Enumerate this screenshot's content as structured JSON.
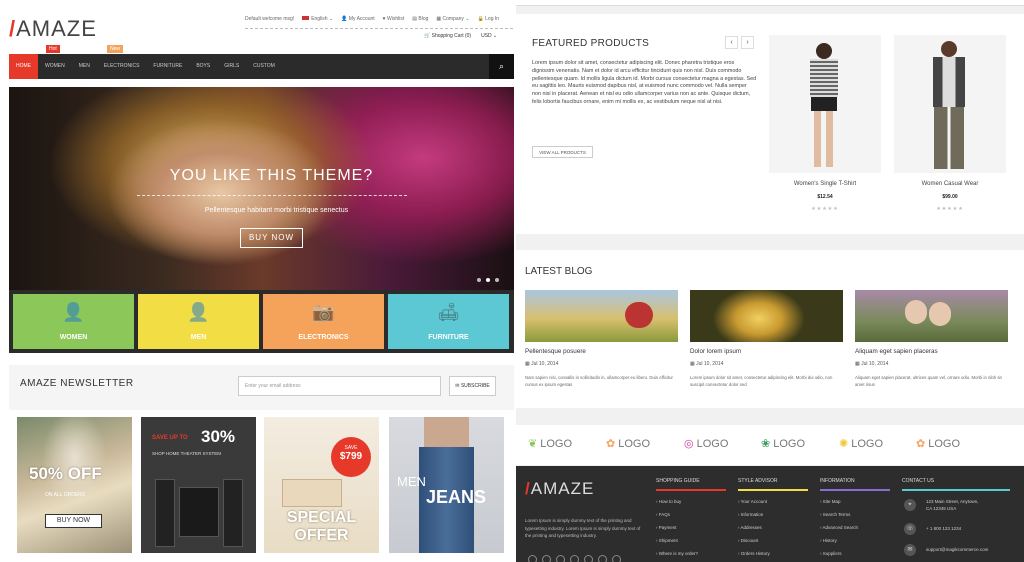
{
  "header": {
    "logo": "AMAZE",
    "welcome": "Default welcome msg!",
    "language": "English",
    "links": [
      "My Account",
      "Wishlist",
      "Blog",
      "Company"
    ],
    "login": "Log In",
    "cart": "Shopping Cart (0)",
    "currency": "USD"
  },
  "nav": {
    "items": [
      "HOME",
      "WOMEN",
      "MEN",
      "ELECTRONICS",
      "FURNITURE",
      "BOYS",
      "GIRLS",
      "CUSTOM"
    ],
    "badges": {
      "hot": "Hot",
      "new": "New"
    }
  },
  "hero": {
    "title": "YOU LIKE THIS THEME?",
    "subtitle": "Pellentesque habitant morbi tristique senectus",
    "button": "BUY NOW"
  },
  "categories": [
    {
      "label": "WOMEN",
      "color": "#8cc759"
    },
    {
      "label": "MEN",
      "color": "#f2dd44"
    },
    {
      "label": "ELECTRONICS",
      "color": "#f5a25b"
    },
    {
      "label": "FURNITURE",
      "color": "#5bc8d3"
    }
  ],
  "newsletter": {
    "title": "AMAZE NEWSLETTER",
    "placeholder": "Enter your email address",
    "button": "SUBSCRIBE"
  },
  "promos": {
    "p1": {
      "big": "50% OFF",
      "small": "ON ALL ORDERS",
      "button": "BUY NOW"
    },
    "p2": {
      "save": "SAVE UP TO",
      "pct": "30%",
      "text": "SHOP HOME THEATER SYSTEM"
    },
    "p3": {
      "save": "SAVE",
      "price": "$799",
      "line1": "SPECIAL",
      "line2": "OFFER"
    },
    "p4": {
      "line1": "MEN",
      "line2": "JEANS"
    }
  },
  "featured": {
    "title": "FEATURED PRODUCTS",
    "prev": "‹",
    "next": "›",
    "description": "Lorem ipsum dolor sit amet, consectetur adipiscing elit. Donec pharetra tristique eros dignissim venenatis. Nam et dolor id arcu efficitur tincidunt quis non nisl. Duis commodo pellentesque quam. Id mollis ligula dictum id. Morbi cursus consectetur magna a egestas. Sed eu sagittis leo. Mauris euismod dapibus nisl, at euismod nunc commodo vel. Nulla semper non nisi in placerat. Aenean et nisl eu odio ullamcorper varius non ac ante. Quisque dictum, felis lobortis faucibus ornare, enim mi mollis ex, ac vestibulum neque nisl at nisi.",
    "view_all": "VIEW ALL PRODUCTS",
    "products": [
      {
        "name": "Women's Single T-Shirt",
        "price": "$12.54",
        "stars": "★★★★★"
      },
      {
        "name": "Women Casual Wear",
        "price": "$99.00",
        "stars": "★★★★★"
      }
    ]
  },
  "blog": {
    "title": "LATEST BLOG",
    "posts": [
      {
        "title": "Pellentesque posuere",
        "date": "Jul 10, 2014",
        "text": "Nam sapien nisi, convallis in sollicitudin in, ullamcorper eu libero. Duis efficitur cursus ex ipsum egestas"
      },
      {
        "title": "Dolor lorem ipsum",
        "date": "Jul 10, 2014",
        "text": "Lorem ipsum dolor sit amet, consectetur adipiscing elit. Morbi dui odio, non suscipit consectetur dolor sed"
      },
      {
        "title": "Aliquam eget sapien placeras",
        "date": "Jul 10, 2014",
        "text": "Aliquam eget sapien placerat, ultrices quam vel, ornare odio. Morbi in nibh sit amet risus"
      }
    ]
  },
  "brand_logos": [
    "LOGO",
    "LOGO",
    "LOGO",
    "LOGO",
    "LOGO",
    "LOGO"
  ],
  "footer": {
    "logo": "AMAZE",
    "about": "Lorem Ipsum is simply dummy text of the printing and typesetting industry. Lorem Ipsum is simply dummy text of the printing and typesetting industry.",
    "columns": [
      {
        "title": "SHOPPING GUIDE",
        "color": "#e7392a",
        "items": [
          "How to buy",
          "FAQs",
          "Payment",
          "Shipment",
          "Where is my order?"
        ]
      },
      {
        "title": "STYLE ADVISOR",
        "color": "#f2dd44",
        "items": [
          "Your Account",
          "Information",
          "Addresses",
          "Discount",
          "Orders History"
        ]
      },
      {
        "title": "INFORMATION",
        "color": "#8b6cd3",
        "items": [
          "Site Map",
          "Search Terms",
          "Advanced Search",
          "History",
          "Suppliers"
        ]
      },
      {
        "title": "CONTACT US",
        "color": "#5bc8d3",
        "items": []
      }
    ],
    "contact": {
      "address1": "123 Main Street, Anytown,",
      "address2": "CA 12345 USA",
      "phone": "+ 1 800 123 1234",
      "email": "support@magikcommerce.com"
    }
  }
}
